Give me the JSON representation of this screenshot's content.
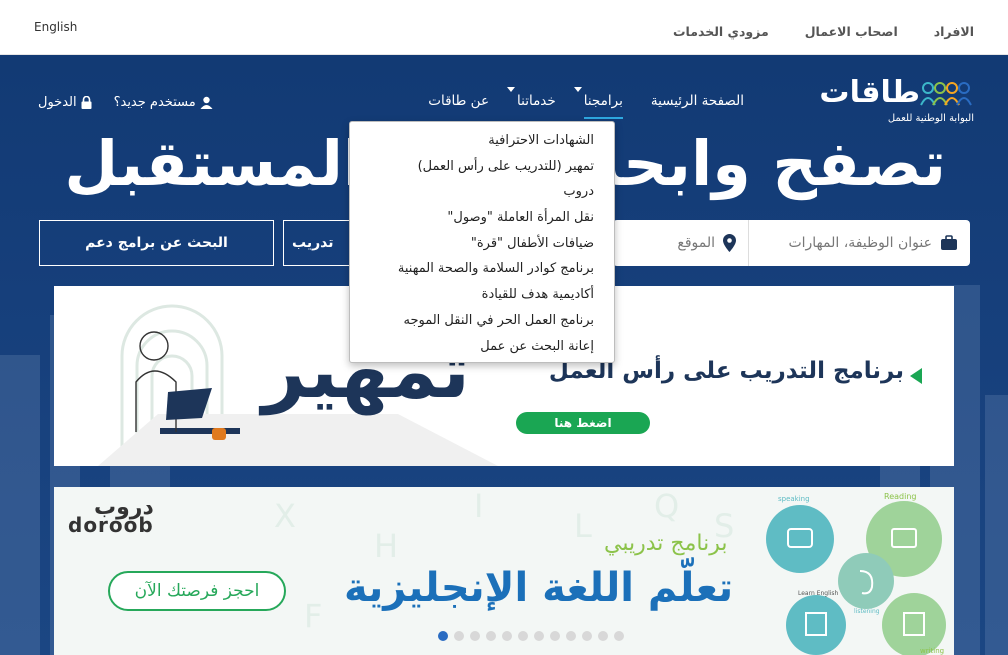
{
  "topbar": {
    "language": "English",
    "links": [
      "الافراد",
      "اصحاب الاعمال",
      "مزودي الخدمات"
    ]
  },
  "logo": {
    "word": "طاقات",
    "subtitle": "البوابة الوطنية للعمل"
  },
  "nav": {
    "items": [
      {
        "label": "الصفحة الرئيسية"
      },
      {
        "label": "برامجنا"
      },
      {
        "label": "خدماتنا"
      },
      {
        "label": "عن طاقات"
      }
    ],
    "new_user": "مستخدم جديد؟",
    "login": "الدخول"
  },
  "hero": {
    "headline": "تصفح وابحث"
  },
  "headline_tail": "المستقبل",
  "search": {
    "job_placeholder": "عنوان الوظيفة، المهارات",
    "location_placeholder": "الموقع",
    "training_button": "تدريب",
    "support_button": "البحث عن برامج دعم"
  },
  "dropdown": {
    "items": [
      "الشهادات الاحترافية",
      "تمهير (للتدريب على رأس العمل)",
      "دروب",
      "نقل المرأة العاملة \"وصول\"",
      "ضيافات الأطفال \"قرة\"",
      "برنامج كوادر السلامة والصحة المهنية",
      "أكاديمية هدف للقيادة",
      "برنامج العمل الحر في النقل الموجه",
      "إعانة البحث عن عمل"
    ]
  },
  "banner1": {
    "brand": "تمهير",
    "tagline": "برنامج التدريب على رأس العمل",
    "cta": "اضغط هنا"
  },
  "banner2": {
    "logo_ar": "دروب",
    "logo_en": "doroob",
    "program": "برنامج تدريبي",
    "title": "تعلّم اللغة الإنجليزية",
    "cta": "احجز فرصتك الآن",
    "skills": [
      "Reading",
      "speaking",
      "listening",
      "Learn English",
      "writing"
    ]
  },
  "carousel": {
    "count": 12,
    "active": 0
  },
  "colors": {
    "brand_blue": "#163f7b",
    "accent_green": "#1aa653",
    "link_blue": "#2a6cc2"
  }
}
